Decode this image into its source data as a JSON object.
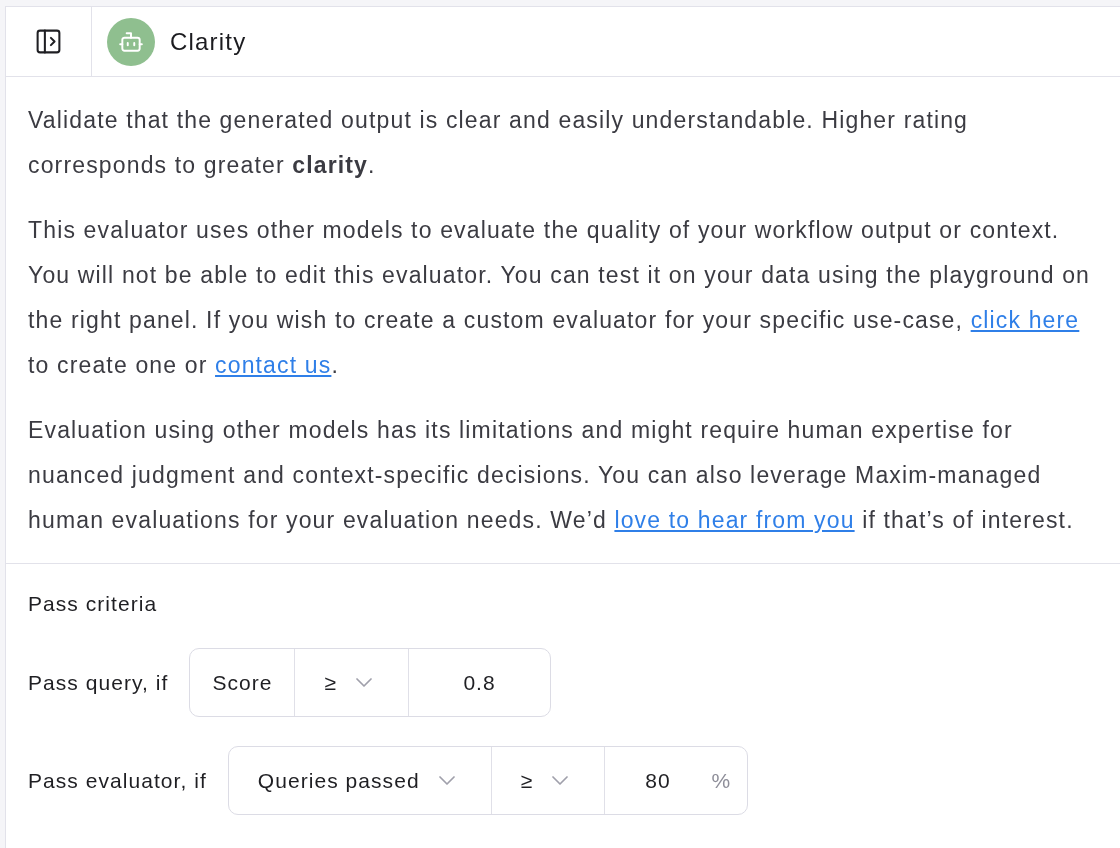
{
  "header": {
    "title": "Clarity"
  },
  "description": [
    {
      "segments": [
        {
          "kind": "text",
          "text": "Validate that the generated output is clear and easily understandable. Higher rating corresponds to greater **clarity**."
        }
      ]
    },
    {
      "segments": [
        {
          "kind": "text",
          "text": "This evaluator uses other models to evaluate the quality of your workflow output or context. You will not be able to edit this evaluator. You can test it on your data using the playground on the right panel. If you wish to create a custom evaluator for your specific use-case, "
        },
        {
          "kind": "link",
          "text": "click here"
        },
        {
          "kind": "text",
          "text": " to create one or "
        },
        {
          "kind": "link",
          "text": "contact us"
        },
        {
          "kind": "text",
          "text": "."
        }
      ]
    },
    {
      "segments": [
        {
          "kind": "text",
          "text": "Evaluation using other models has its limitations and might require human expertise for nuanced judgment and context-specific decisions. You can also leverage Maxim-managed human evaluations for your evaluation needs. We’d "
        },
        {
          "kind": "link",
          "text": "love to hear from you"
        },
        {
          "kind": "text",
          "text": " if that’s of interest."
        }
      ]
    }
  ],
  "pass_criteria": {
    "title": "Pass criteria",
    "rows": [
      {
        "label": "Pass query, if",
        "fields": [
          {
            "kind": "fixed",
            "value": "Score"
          },
          {
            "kind": "select",
            "value": "≥"
          },
          {
            "kind": "input",
            "value": "0.8"
          }
        ]
      },
      {
        "label": "Pass evaluator, if",
        "fields": [
          {
            "kind": "select",
            "value": "Queries passed"
          },
          {
            "kind": "select",
            "value": "≥"
          },
          {
            "kind": "input",
            "value": "80",
            "unit": "%"
          }
        ]
      }
    ]
  }
}
